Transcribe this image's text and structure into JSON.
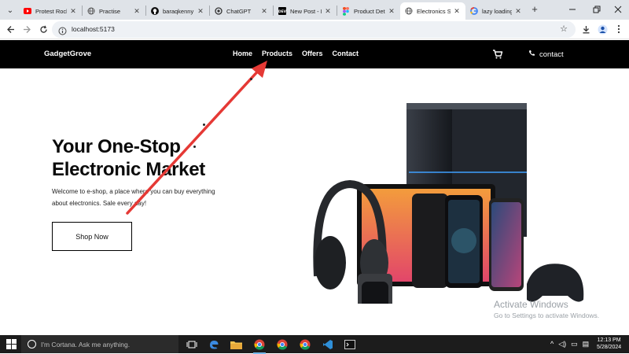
{
  "browser": {
    "tabs": [
      {
        "title": "Protest Rock",
        "favicon": "youtube-icon",
        "active": false
      },
      {
        "title": "Practise",
        "favicon": "globe-icon",
        "active": false
      },
      {
        "title": "baraqkenny",
        "favicon": "github-icon",
        "active": false
      },
      {
        "title": "ChatGPT",
        "favicon": "chatgpt-icon",
        "active": false
      },
      {
        "title": "New Post - D",
        "favicon": "dev-icon",
        "active": false
      },
      {
        "title": "Product Deta",
        "favicon": "figma-icon",
        "active": false
      },
      {
        "title": "Electronics S",
        "favicon": "globe-icon",
        "active": true
      },
      {
        "title": "lazy loading",
        "favicon": "google-icon",
        "active": false
      }
    ],
    "address": "localhost:5173"
  },
  "site": {
    "brand": "GadgetGrove",
    "menu": [
      "Home",
      "Products",
      "Offers",
      "Contact"
    ],
    "contact_label": "contact",
    "hero": {
      "title": "Your One-Stop Electronic Market",
      "text": "Welcome to e-shop, a place where you can buy everything about electronics. Sale every day!",
      "button": "Shop Now"
    }
  },
  "overlay": {
    "activate_title": "Activate Windows",
    "activate_sub": "Go to Settings to activate Windows."
  },
  "taskbar": {
    "search_placeholder": "I'm Cortana. Ask me anything.",
    "time": "12:13 PM",
    "date": "5/28/2024"
  },
  "colors": {
    "nav_bg": "#000000",
    "arrow": "#e53935",
    "tabstrip": "#dfe3e8",
    "taskbar": "#1c1c1c"
  }
}
